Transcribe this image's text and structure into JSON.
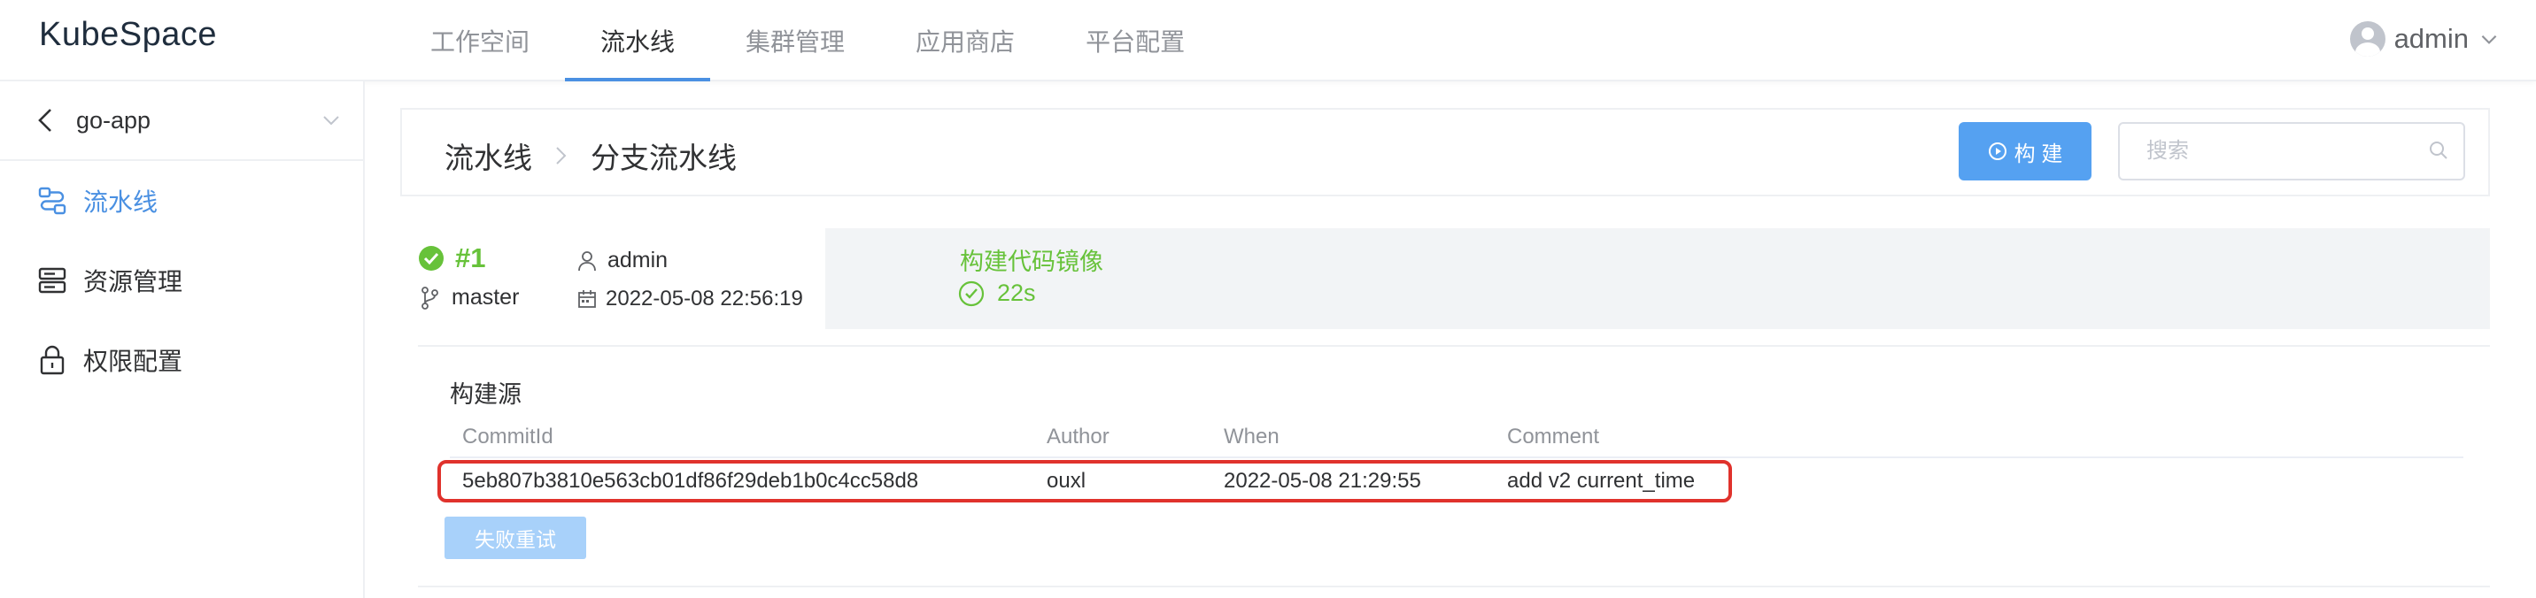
{
  "app": {
    "title": "KubeSpace"
  },
  "topnav": {
    "items": [
      {
        "label": "工作空间",
        "active": false
      },
      {
        "label": "流水线",
        "active": true
      },
      {
        "label": "集群管理",
        "active": false
      },
      {
        "label": "应用商店",
        "active": false
      },
      {
        "label": "平台配置",
        "active": false
      }
    ]
  },
  "user": {
    "name": "admin"
  },
  "sidebar": {
    "project": "go-app",
    "items": [
      {
        "label": "流水线",
        "icon": "pipeline-icon",
        "active": true
      },
      {
        "label": "资源管理",
        "icon": "server-icon",
        "active": false
      },
      {
        "label": "权限配置",
        "icon": "lock-icon",
        "active": false
      }
    ]
  },
  "breadcrumb": {
    "parent": "流水线",
    "current": "分支流水线"
  },
  "toolbar": {
    "build_label": "构 建",
    "search_placeholder": "搜索"
  },
  "run": {
    "id": "#1",
    "status": "success",
    "branch": "master",
    "user": "admin",
    "time": "2022-05-08 22:56:19"
  },
  "stage": {
    "name": "构建代码镜像",
    "duration": "22s"
  },
  "build_source": {
    "title": "构建源",
    "columns": [
      "CommitId",
      "Author",
      "When",
      "Comment"
    ],
    "rows": [
      {
        "commit_id": "5eb807b3810e563cb01df86f29deb1b0c4cc58d8",
        "author": "ouxl",
        "when": "2022-05-08 21:29:55",
        "comment": "add v2 current_time"
      }
    ],
    "retry_label": "失败重试"
  },
  "colors": {
    "accent": "#4a90e2",
    "success": "#67c23a",
    "button": "#55a1f1",
    "button_disabled": "#a8d1fa",
    "highlight": "#e0322c"
  }
}
